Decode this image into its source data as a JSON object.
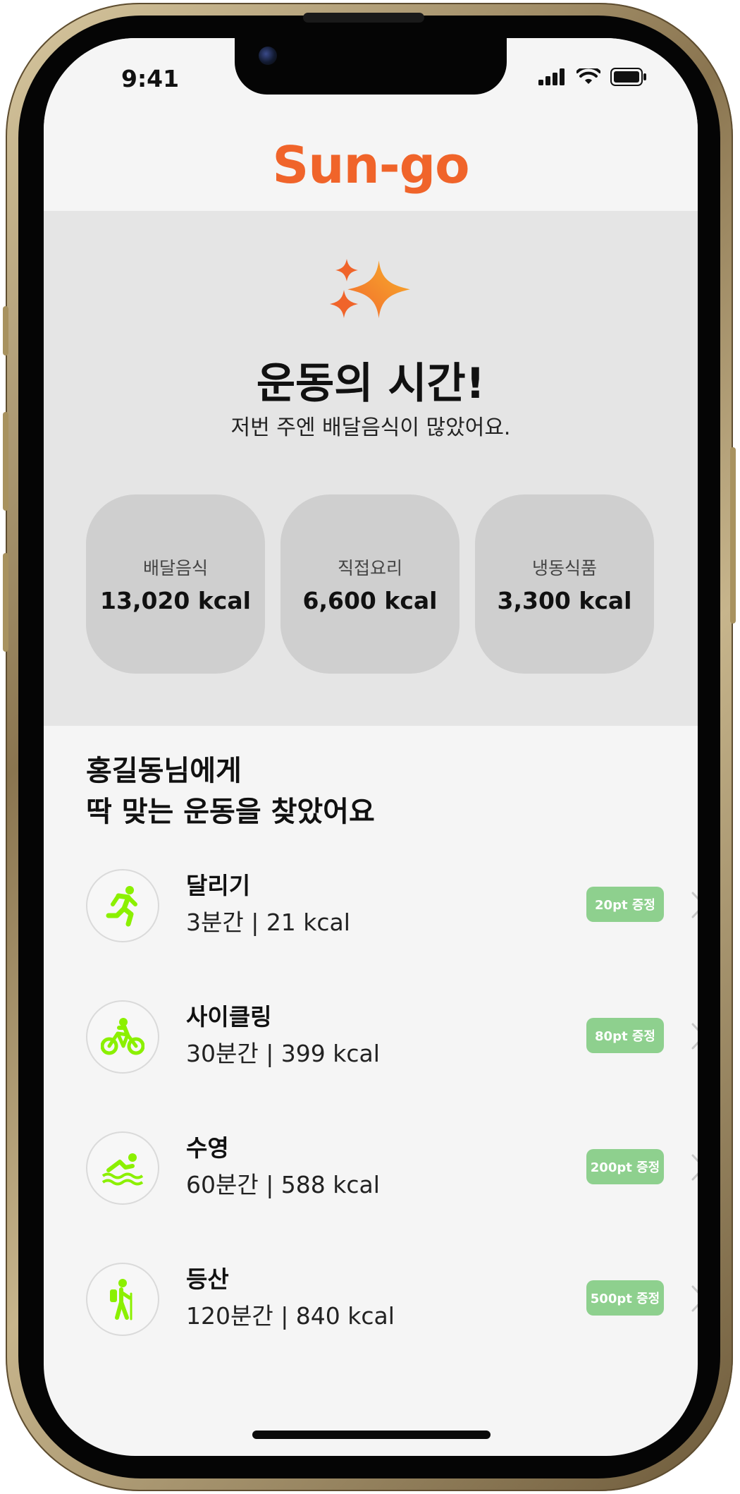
{
  "status_bar": {
    "time": "9:41",
    "icons": [
      "signal-icon",
      "wifi-icon",
      "battery-icon"
    ]
  },
  "brand": {
    "name": "Sun-go",
    "color": "#f0642a"
  },
  "hero": {
    "icon": "sparkle-icon",
    "title": "운동의 시간!",
    "subtitle": "저번 주엔 배달음식이 많았어요."
  },
  "stats": [
    {
      "label": "배달음식",
      "value": "13,020 kcal"
    },
    {
      "label": "직접요리",
      "value": "6,600 kcal"
    },
    {
      "label": "냉동식품",
      "value": "3,300 kcal"
    }
  ],
  "section": {
    "title_line1": "홍길동님에게",
    "title_line2": "딱 맞는 운동을 찾았어요"
  },
  "exercises": [
    {
      "name": "달리기",
      "info": "3분간 | 21 kcal",
      "badge": "20pt 증정",
      "icon": "running-icon"
    },
    {
      "name": "사이클링",
      "info": "30분간 | 399 kcal",
      "badge": "80pt 증정",
      "icon": "cycling-icon"
    },
    {
      "name": "수영",
      "info": "60분간 | 588 kcal",
      "badge": "200pt 증정",
      "icon": "swimming-icon"
    },
    {
      "name": "등산",
      "info": "120분간 | 840 kcal",
      "badge": "500pt 증정",
      "icon": "hiking-icon"
    }
  ],
  "colors": {
    "accent": "#f0642a",
    "badge": "#8ed08e",
    "exercise_icon": "#8bf000"
  }
}
